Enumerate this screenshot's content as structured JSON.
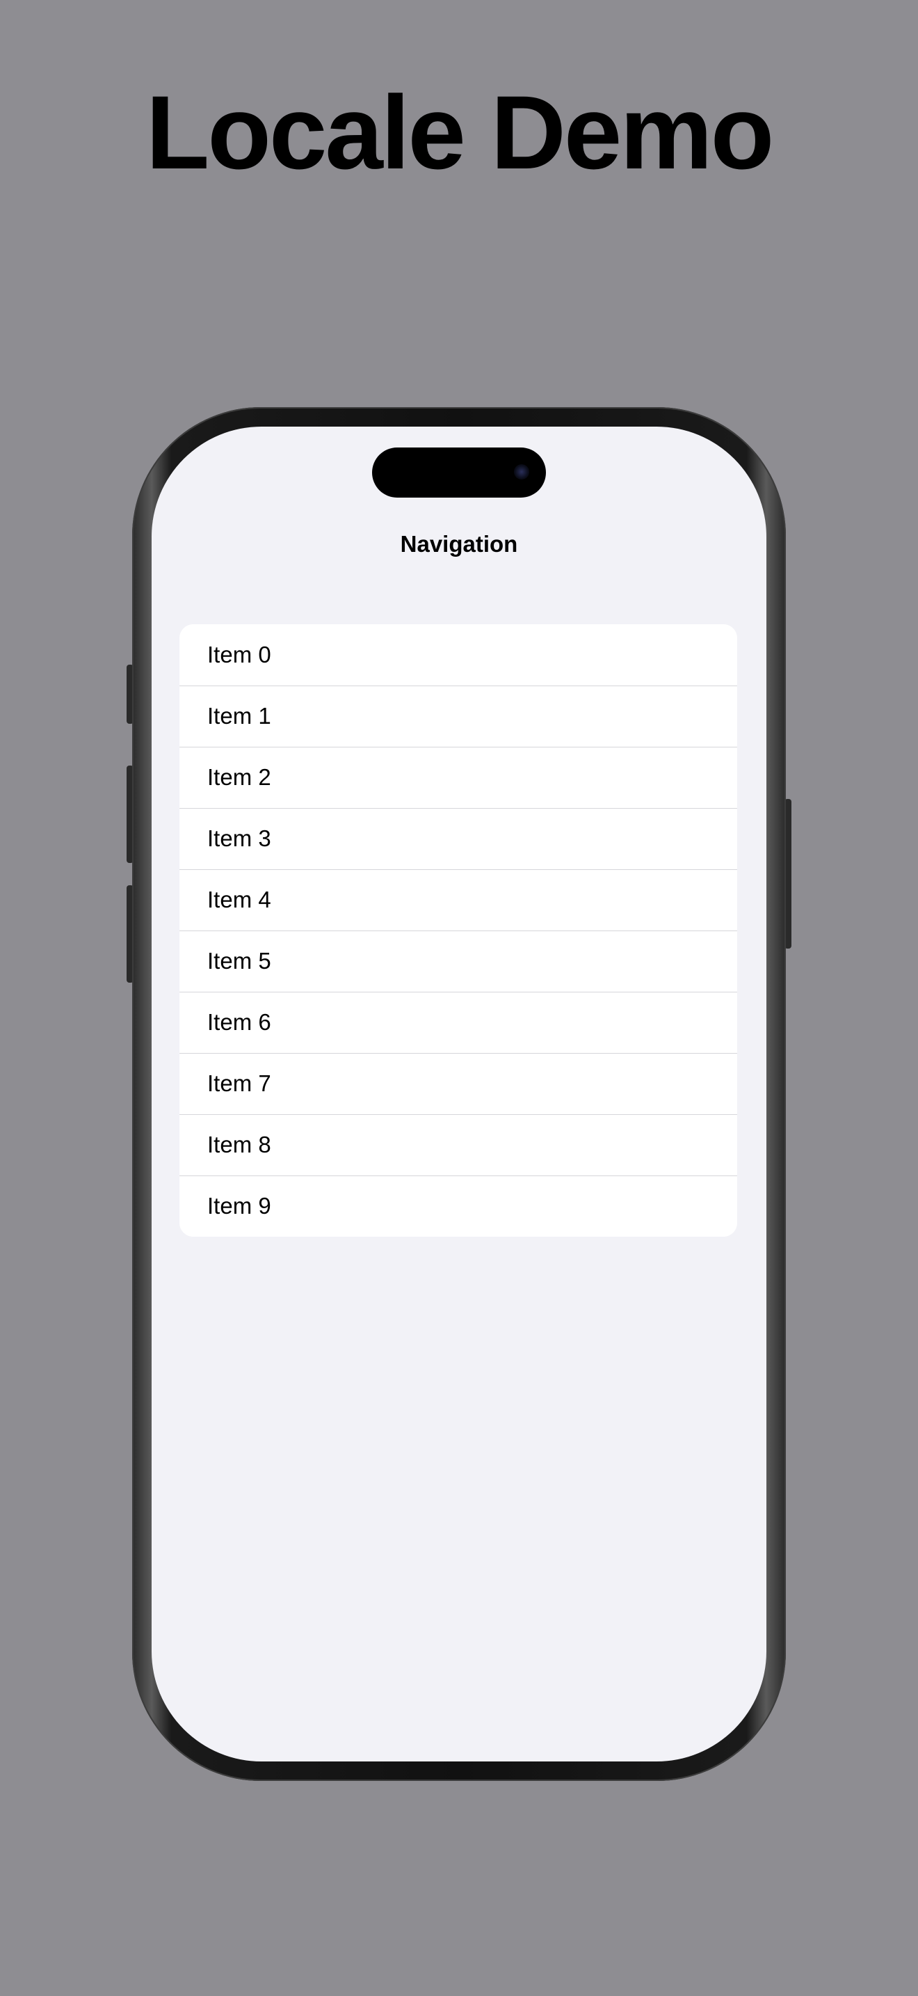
{
  "page": {
    "title": "Locale Demo"
  },
  "screen": {
    "nav_title": "Navigation",
    "items": [
      {
        "label": "Item 0"
      },
      {
        "label": "Item 1"
      },
      {
        "label": "Item 2"
      },
      {
        "label": "Item 3"
      },
      {
        "label": "Item 4"
      },
      {
        "label": "Item 5"
      },
      {
        "label": "Item 6"
      },
      {
        "label": "Item 7"
      },
      {
        "label": "Item 8"
      },
      {
        "label": "Item 9"
      }
    ]
  },
  "colors": {
    "background": "#8e8d92",
    "screen_background": "#f2f2f7",
    "cell_background": "#ffffff"
  }
}
